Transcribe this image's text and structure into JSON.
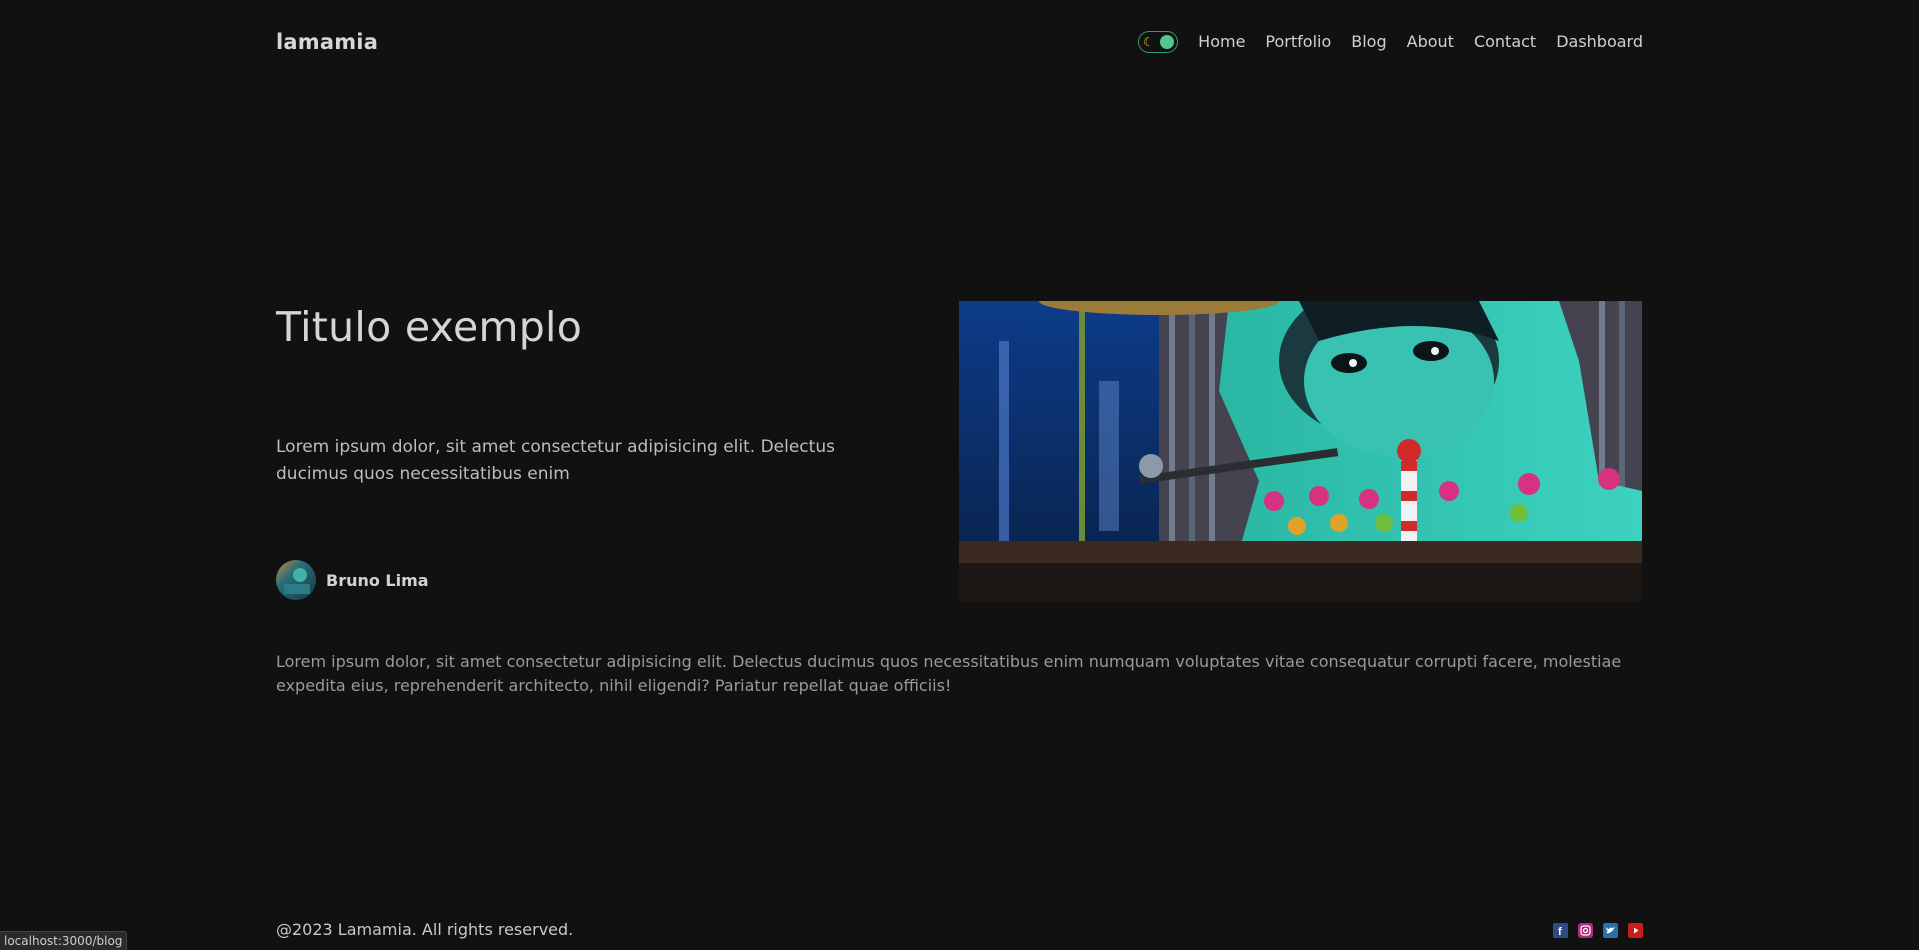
{
  "header": {
    "logo": "lamamia",
    "nav": [
      "Home",
      "Portfolio",
      "Blog",
      "About",
      "Contact",
      "Dashboard"
    ],
    "toggle_icon": "moon-icon",
    "toggle_color": "#53c68c"
  },
  "post": {
    "title": "Titulo exemplo",
    "lead": "Lorem ipsum dolor, sit amet consectetur adipisicing elit. Delectus ducimus quos necessitatibus enim",
    "author": "Bruno Lima",
    "body": "Lorem ipsum dolor, sit amet consectetur adipisicing elit. Delectus ducimus quos necessitatibus enim numquam voluptates vitae consequatur corrupti facere, molestiae expedita eius, reprehenderit architecto, nihil eligendi? Pariatur repellat quae officiis!"
  },
  "footer": {
    "copyright": "@2023 Lamamia. All rights reserved.",
    "socials": [
      {
        "icon": "facebook-icon",
        "color": "#3b5998"
      },
      {
        "icon": "instagram-icon",
        "color": "#c13584"
      },
      {
        "icon": "twitter-icon",
        "color": "#1da1f2"
      },
      {
        "icon": "youtube-icon",
        "color": "#e62117"
      }
    ]
  },
  "status_bar": {
    "url": "localhost:3000/blog"
  }
}
